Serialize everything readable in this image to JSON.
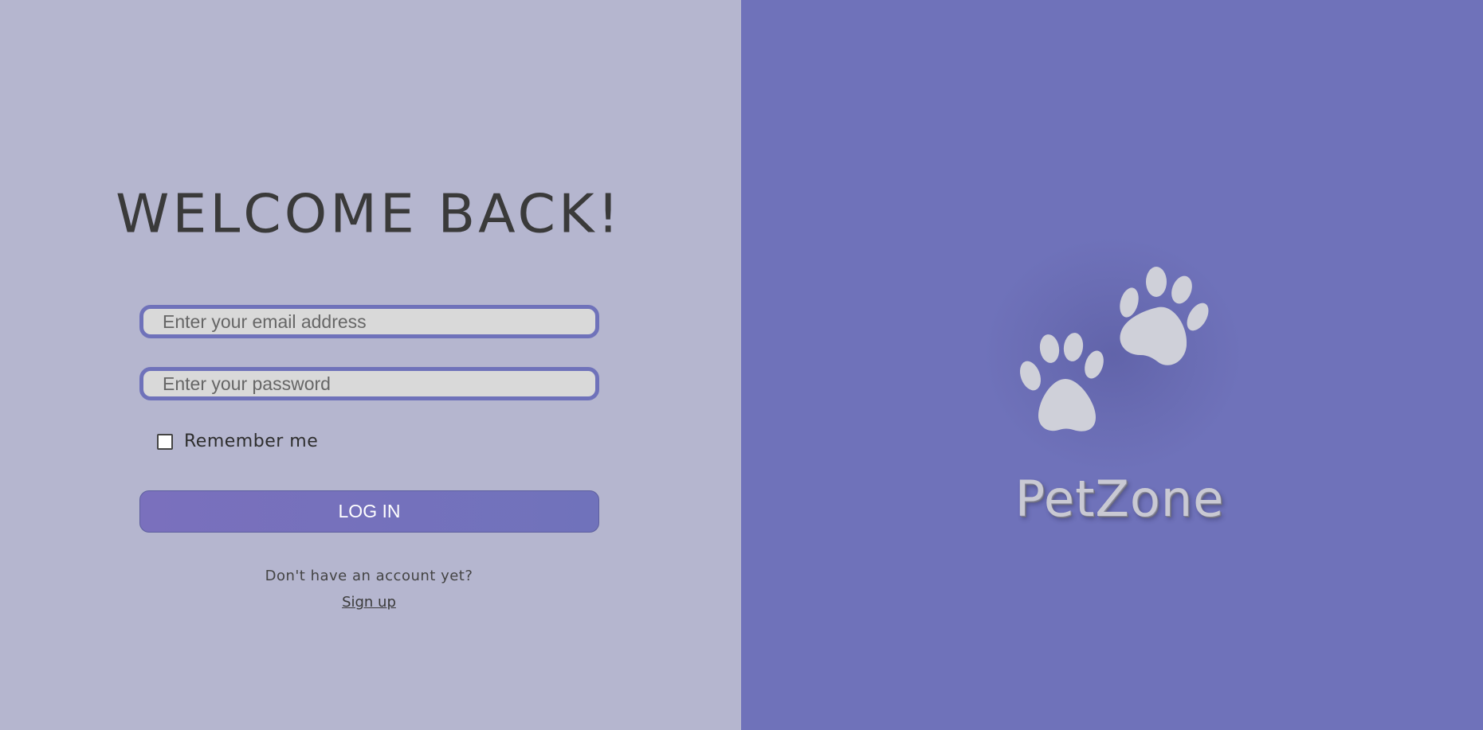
{
  "login": {
    "title": "WELCOME BACK!",
    "email_placeholder": "Enter your email address",
    "password_placeholder": "Enter your password",
    "remember_label": "Remember me",
    "remember_checked": false,
    "submit_label": "LOG IN",
    "signup_prompt": "Don't have an account yet?",
    "signup_link": "Sign up"
  },
  "brand": {
    "name": "PetZone",
    "logo_icon": "paw-prints-icon"
  },
  "colors": {
    "left_background": "#b5b6cf",
    "right_background": "#6f72ba",
    "accent": "#6f72ba",
    "input_fill": "#d9d9d9",
    "logo_fill": "#cfd0d9"
  }
}
